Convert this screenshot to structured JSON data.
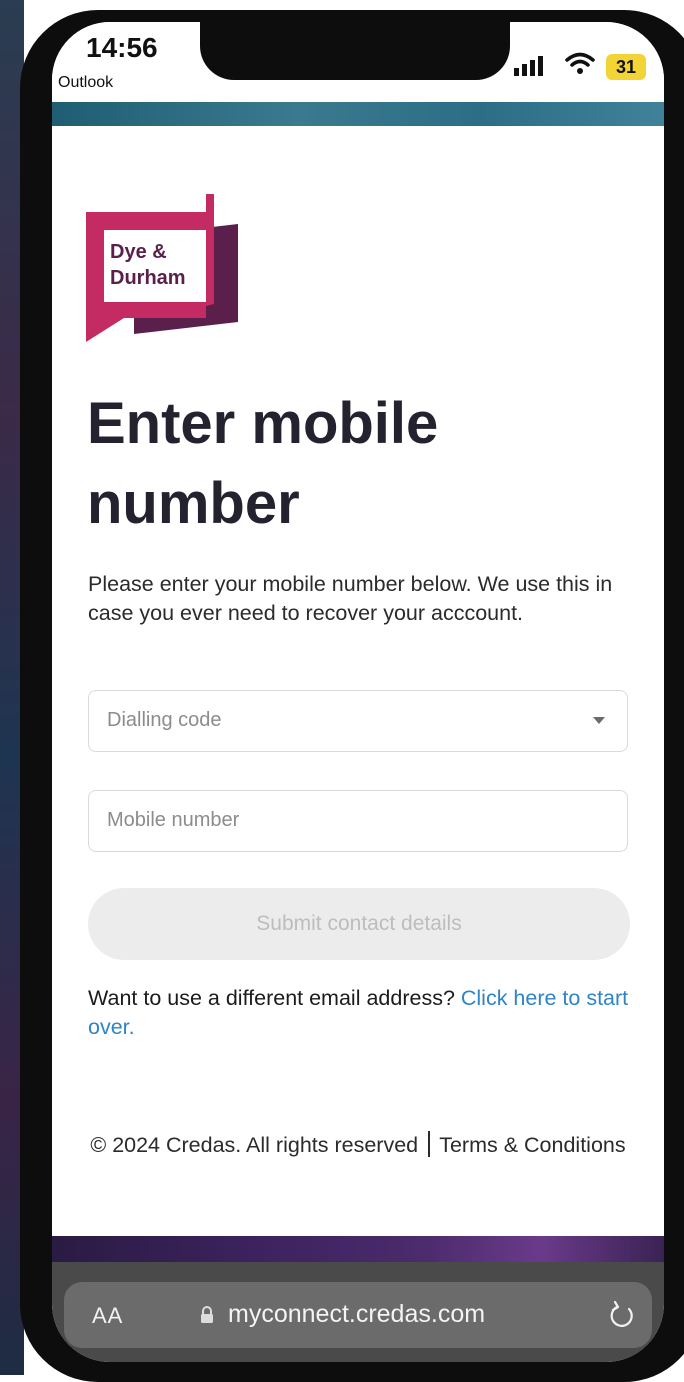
{
  "status_bar": {
    "time": "14:56",
    "back_app": "Outlook",
    "battery": "31",
    "battery_color": "#f3d437"
  },
  "logo": {
    "line1": "Dye &",
    "line2": "Durham",
    "brand_color": "#c52b63",
    "accent_color": "#5a1f4b"
  },
  "page": {
    "title_line1": "Enter mobile",
    "title_line2": "number",
    "intro": "Please enter your mobile number below. We use this in case you ever need to recover your acccount."
  },
  "form": {
    "dialling_code_placeholder": "Dialling code",
    "mobile_placeholder": "Mobile number",
    "submit_label": "Submit contact details"
  },
  "alt_email": {
    "text": "Want to use a different email address? ",
    "link": "Click here to start over.",
    "link_color": "#2f84c8"
  },
  "footer": {
    "copyright": "© 2024 Credas. All rights reserved",
    "terms": "Terms & Conditions"
  },
  "browser": {
    "text_size": "AA",
    "url": "myconnect.credas.com"
  }
}
